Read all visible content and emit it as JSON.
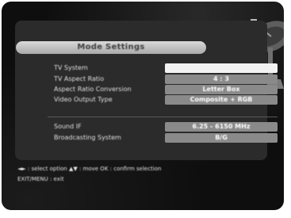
{
  "menu": {
    "title": "Mode Settings"
  },
  "rows": [
    {
      "label": "TV System",
      "value": ""
    },
    {
      "label": "TV Aspect Ratio",
      "value": "4 : 3"
    },
    {
      "label": "Aspect Ratio Conversion",
      "value": "Letter Box"
    },
    {
      "label": "Video Output Type",
      "value": "Composite + RGB"
    },
    {
      "label": "Sound IF",
      "value": "6.25 - 6150 MHz"
    },
    {
      "label": "Broadcasting System",
      "value": "B/G"
    }
  ],
  "help": {
    "line1": "◄► : select option  ▲▼ : move  OK : confirm selection",
    "line2": "EXIT/MENU : exit"
  },
  "colors": {
    "screen": "#0e0e0e",
    "panel": "#2b2b2b",
    "title_bar": "#c4c4c4",
    "value_box": "#8a8a8a",
    "value_box_selected": "#f2f2f2",
    "text": "#e0e0e0"
  },
  "icons": {
    "decoration": "satellite-dish-icon"
  }
}
